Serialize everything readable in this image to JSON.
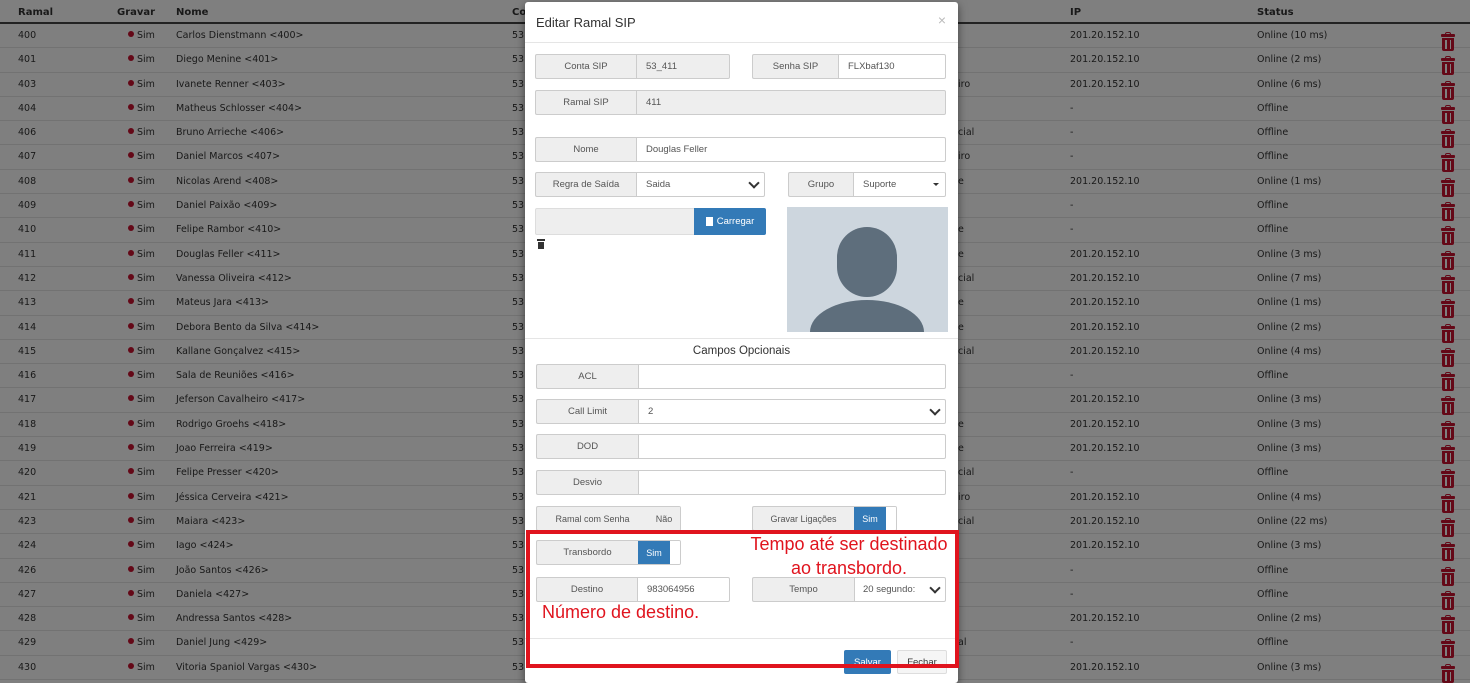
{
  "table": {
    "headers": {
      "ramal": "Ramal",
      "gravar": "Gravar",
      "nome": "Nome",
      "conta": "Co",
      "ip": "IP",
      "status": "Status"
    },
    "rows": [
      {
        "ramal": "400",
        "gravar": "Sim",
        "nome": "Carlos Dienstmann <400>",
        "conta": "53",
        "grupo": "",
        "ip": "201.20.152.10",
        "status": "Online (10 ms)"
      },
      {
        "ramal": "401",
        "gravar": "Sim",
        "nome": "Diego Menine <401>",
        "conta": "53",
        "grupo": "",
        "ip": "201.20.152.10",
        "status": "Online (2 ms)"
      },
      {
        "ramal": "403",
        "gravar": "Sim",
        "nome": "Ivanete Renner <403>",
        "conta": "53",
        "grupo": "iro",
        "ip": "201.20.152.10",
        "status": "Online (6 ms)"
      },
      {
        "ramal": "404",
        "gravar": "Sim",
        "nome": "Matheus Schlosser <404>",
        "conta": "53",
        "grupo": "",
        "ip": "-",
        "status": "Offline"
      },
      {
        "ramal": "406",
        "gravar": "Sim",
        "nome": "Bruno Arrieche <406>",
        "conta": "53",
        "grupo": "cial",
        "ip": "-",
        "status": "Offline"
      },
      {
        "ramal": "407",
        "gravar": "Sim",
        "nome": "Daniel Marcos <407>",
        "conta": "53",
        "grupo": "iro",
        "ip": "-",
        "status": "Offline"
      },
      {
        "ramal": "408",
        "gravar": "Sim",
        "nome": "Nicolas Arend <408>",
        "conta": "53",
        "grupo": "e",
        "ip": "201.20.152.10",
        "status": "Online (1 ms)"
      },
      {
        "ramal": "409",
        "gravar": "Sim",
        "nome": "Daniel Paixão <409>",
        "conta": "53",
        "grupo": "",
        "ip": "-",
        "status": "Offline"
      },
      {
        "ramal": "410",
        "gravar": "Sim",
        "nome": "Felipe Rambor <410>",
        "conta": "53",
        "grupo": "e",
        "ip": "-",
        "status": "Offline"
      },
      {
        "ramal": "411",
        "gravar": "Sim",
        "nome": "Douglas Feller <411>",
        "conta": "53",
        "grupo": "e",
        "ip": "201.20.152.10",
        "status": "Online (3 ms)"
      },
      {
        "ramal": "412",
        "gravar": "Sim",
        "nome": "Vanessa Oliveira <412>",
        "conta": "53",
        "grupo": "cial",
        "ip": "201.20.152.10",
        "status": "Online (7 ms)"
      },
      {
        "ramal": "413",
        "gravar": "Sim",
        "nome": "Mateus Jara <413>",
        "conta": "53",
        "grupo": "e",
        "ip": "201.20.152.10",
        "status": "Online (1 ms)"
      },
      {
        "ramal": "414",
        "gravar": "Sim",
        "nome": "Debora Bento da Silva <414>",
        "conta": "53",
        "grupo": "e",
        "ip": "201.20.152.10",
        "status": "Online (2 ms)"
      },
      {
        "ramal": "415",
        "gravar": "Sim",
        "nome": "Kallane Gonçalvez <415>",
        "conta": "53",
        "grupo": "cial",
        "ip": "201.20.152.10",
        "status": "Online (4 ms)"
      },
      {
        "ramal": "416",
        "gravar": "Sim",
        "nome": "Sala de Reuniões <416>",
        "conta": "53",
        "grupo": "",
        "ip": "-",
        "status": "Offline"
      },
      {
        "ramal": "417",
        "gravar": "Sim",
        "nome": "Jeferson Cavalheiro <417>",
        "conta": "53",
        "grupo": "",
        "ip": "201.20.152.10",
        "status": "Online (3 ms)"
      },
      {
        "ramal": "418",
        "gravar": "Sim",
        "nome": "Rodrigo Groehs <418>",
        "conta": "53",
        "grupo": "e",
        "ip": "201.20.152.10",
        "status": "Online (3 ms)"
      },
      {
        "ramal": "419",
        "gravar": "Sim",
        "nome": "Joao Ferreira <419>",
        "conta": "53",
        "grupo": "e",
        "ip": "201.20.152.10",
        "status": "Online (3 ms)"
      },
      {
        "ramal": "420",
        "gravar": "Sim",
        "nome": "Felipe Presser <420>",
        "conta": "53",
        "grupo": "cial",
        "ip": "-",
        "status": "Offline"
      },
      {
        "ramal": "421",
        "gravar": "Sim",
        "nome": "Jéssica Cerveira <421>",
        "conta": "53",
        "grupo": "iro",
        "ip": "201.20.152.10",
        "status": "Online (4 ms)"
      },
      {
        "ramal": "423",
        "gravar": "Sim",
        "nome": "Maiara <423>",
        "conta": "53",
        "grupo": "cial",
        "ip": "201.20.152.10",
        "status": "Online (22 ms)"
      },
      {
        "ramal": "424",
        "gravar": "Sim",
        "nome": "Iago <424>",
        "conta": "53",
        "grupo": "",
        "ip": "201.20.152.10",
        "status": "Online (3 ms)"
      },
      {
        "ramal": "426",
        "gravar": "Sim",
        "nome": "João Santos <426>",
        "conta": "53",
        "grupo": "",
        "ip": "-",
        "status": "Offline"
      },
      {
        "ramal": "427",
        "gravar": "Sim",
        "nome": "Daniela <427>",
        "conta": "53",
        "grupo": "",
        "ip": "-",
        "status": "Offline"
      },
      {
        "ramal": "428",
        "gravar": "Sim",
        "nome": "Andressa Santos <428>",
        "conta": "53",
        "grupo": "",
        "ip": "201.20.152.10",
        "status": "Online (2 ms)"
      },
      {
        "ramal": "429",
        "gravar": "Sim",
        "nome": "Daniel Jung <429>",
        "conta": "53",
        "grupo": "al",
        "ip": "-",
        "status": "Offline"
      },
      {
        "ramal": "430",
        "gravar": "Sim",
        "nome": "Vitoria Spaniol Vargas <430>",
        "conta": "53",
        "grupo": "",
        "ip": "201.20.152.10",
        "status": "Online (3 ms)"
      }
    ]
  },
  "modal": {
    "title": "Editar Ramal SIP",
    "close": "×",
    "conta_sip": {
      "label": "Conta SIP",
      "value": "53_411"
    },
    "senha_sip": {
      "label": "Senha SIP",
      "value": "FLXbaf130"
    },
    "ramal_sip": {
      "label": "Ramal SIP",
      "value": "411"
    },
    "nome": {
      "label": "Nome",
      "value": "Douglas Feller"
    },
    "regra_saida": {
      "label": "Regra de Saída",
      "value": "Saida"
    },
    "grupo": {
      "label": "Grupo",
      "value": "Suporte"
    },
    "upload_button": "Carregar",
    "campos_opcionais": "Campos Opcionais",
    "acl": {
      "label": "ACL",
      "value": ""
    },
    "call_limit": {
      "label": "Call Limit",
      "value": "2"
    },
    "dod": {
      "label": "DOD",
      "value": ""
    },
    "desvio": {
      "label": "Desvio",
      "value": ""
    },
    "ramal_com_senha": {
      "label": "Ramal com Senha",
      "value": "Não"
    },
    "gravar_ligacoes": {
      "label": "Gravar Ligações",
      "value": "Sim"
    },
    "transbordo": {
      "label": "Transbordo",
      "value": "Sim"
    },
    "destino": {
      "label": "Destino",
      "value": "983064956"
    },
    "tempo": {
      "label": "Tempo",
      "value": "20 segundo:"
    },
    "save_button": "Salvar",
    "close_button": "Fechar"
  },
  "annotations": {
    "tempo_line1": "Tempo até ser destinado",
    "tempo_line2": "ao transbordo.",
    "destino": "Número de destino."
  },
  "colors": {
    "primary": "#337ab7",
    "delete": "#c8102e",
    "annotation": "#e0141e"
  }
}
